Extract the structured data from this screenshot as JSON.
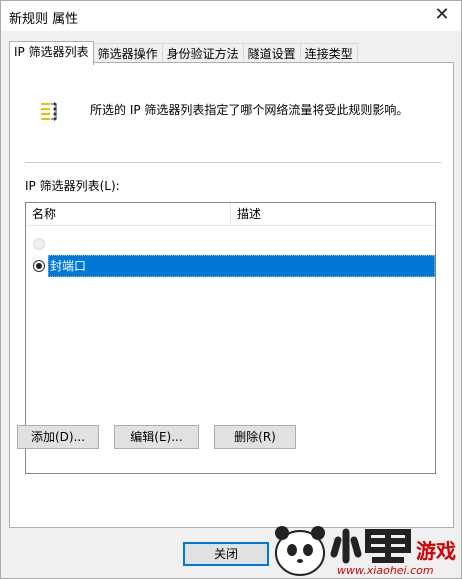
{
  "window": {
    "title": "新规则 属性",
    "close_glyph": "✕"
  },
  "tabs": [
    {
      "label": "IP 筛选器列表",
      "active": true
    },
    {
      "label": "筛选器操作"
    },
    {
      "label": "身份验证方法"
    },
    {
      "label": "隧道设置"
    },
    {
      "label": "连接类型"
    }
  ],
  "info": {
    "icon": "filter-list-icon",
    "text": "所选的 IP 筛选器列表指定了哪个网络流量将受此规则影响。"
  },
  "list": {
    "label": "IP 筛选器列表(L):",
    "columns": [
      "名称",
      "描述"
    ],
    "rows": [
      {
        "name": "",
        "description": "",
        "selected": false
      },
      {
        "name": "封端口",
        "description": "",
        "selected": true
      }
    ]
  },
  "buttons": {
    "add": "添加(D)...",
    "edit": "编辑(E)...",
    "delete": "删除(R)",
    "close": "关闭"
  },
  "watermark": {
    "text": "www.xiaohei.com",
    "icon": "panda-logo-icon"
  },
  "colors": {
    "selection": "#0078d7",
    "accent": "#0078d7"
  }
}
